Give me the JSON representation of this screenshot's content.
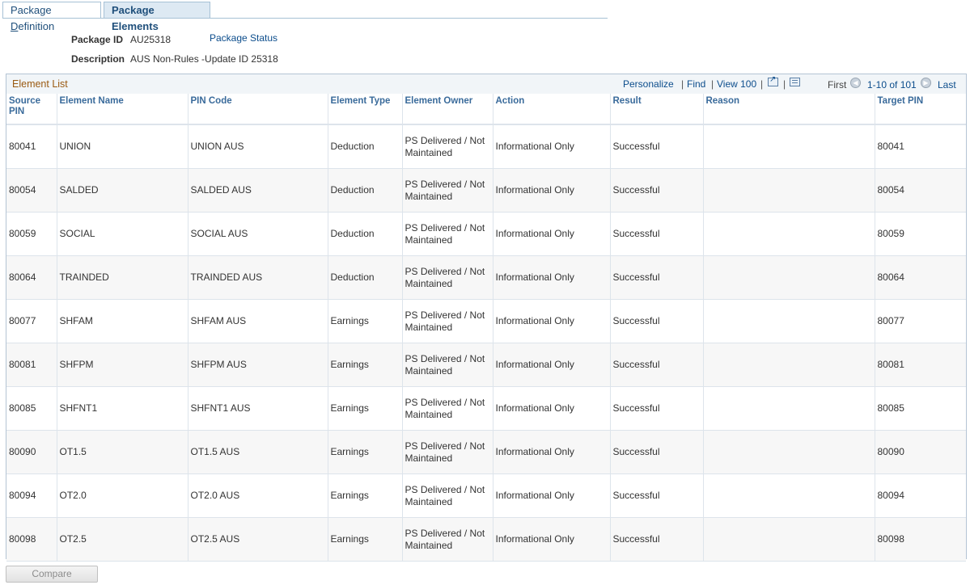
{
  "tabs": {
    "definition_pre": "Package ",
    "definition_underline": "D",
    "definition_post": "efinition",
    "elements": "Package Elements"
  },
  "header": {
    "package_id_label": "Package ID",
    "package_id_value": "AU25318",
    "package_status_link": "Package Status",
    "description_label": "Description",
    "description_value": "AUS Non-Rules -Update ID 25318"
  },
  "grid": {
    "title": "Element List",
    "personalize": "Personalize",
    "find": "Find",
    "view": "View 100",
    "separator": "|",
    "first": "First",
    "range": "1-10 of 101",
    "last": "Last",
    "columns": [
      "Source PIN",
      "Element Name",
      "PIN Code",
      "Element Type",
      "Element Owner",
      "Action",
      "Result",
      "Reason",
      "Target PIN"
    ],
    "rows": [
      {
        "source_pin": "80041",
        "element_name": "UNION",
        "pin_code": "UNION AUS",
        "element_type": "Deduction",
        "element_owner": "PS Delivered / Not Maintained",
        "action": "Informational Only",
        "result": "Successful",
        "reason": "",
        "target_pin": "80041"
      },
      {
        "source_pin": "80054",
        "element_name": "SALDED",
        "pin_code": "SALDED AUS",
        "element_type": "Deduction",
        "element_owner": "PS Delivered / Not Maintained",
        "action": "Informational Only",
        "result": "Successful",
        "reason": "",
        "target_pin": "80054"
      },
      {
        "source_pin": "80059",
        "element_name": "SOCIAL",
        "pin_code": "SOCIAL AUS",
        "element_type": "Deduction",
        "element_owner": "PS Delivered / Not Maintained",
        "action": "Informational Only",
        "result": "Successful",
        "reason": "",
        "target_pin": "80059"
      },
      {
        "source_pin": "80064",
        "element_name": "TRAINDED",
        "pin_code": "TRAINDED AUS",
        "element_type": "Deduction",
        "element_owner": "PS Delivered / Not Maintained",
        "action": "Informational Only",
        "result": "Successful",
        "reason": "",
        "target_pin": "80064"
      },
      {
        "source_pin": "80077",
        "element_name": "SHFAM",
        "pin_code": "SHFAM AUS",
        "element_type": "Earnings",
        "element_owner": "PS Delivered / Not Maintained",
        "action": "Informational Only",
        "result": "Successful",
        "reason": "",
        "target_pin": "80077"
      },
      {
        "source_pin": "80081",
        "element_name": "SHFPM",
        "pin_code": "SHFPM AUS",
        "element_type": "Earnings",
        "element_owner": "PS Delivered / Not Maintained",
        "action": "Informational Only",
        "result": "Successful",
        "reason": "",
        "target_pin": "80081"
      },
      {
        "source_pin": "80085",
        "element_name": "SHFNT1",
        "pin_code": "SHFNT1 AUS",
        "element_type": "Earnings",
        "element_owner": "PS Delivered / Not Maintained",
        "action": "Informational Only",
        "result": "Successful",
        "reason": "",
        "target_pin": "80085"
      },
      {
        "source_pin": "80090",
        "element_name": "OT1.5",
        "pin_code": "OT1.5 AUS",
        "element_type": "Earnings",
        "element_owner": "PS Delivered / Not Maintained",
        "action": "Informational Only",
        "result": "Successful",
        "reason": "",
        "target_pin": "80090"
      },
      {
        "source_pin": "80094",
        "element_name": "OT2.0",
        "pin_code": "OT2.0 AUS",
        "element_type": "Earnings",
        "element_owner": "PS Delivered / Not Maintained",
        "action": "Informational Only",
        "result": "Successful",
        "reason": "",
        "target_pin": "80094"
      },
      {
        "source_pin": "80098",
        "element_name": "OT2.5",
        "pin_code": "OT2.5 AUS",
        "element_type": "Earnings",
        "element_owner": "PS Delivered / Not Maintained",
        "action": "Informational Only",
        "result": "Successful",
        "reason": "",
        "target_pin": "80098"
      }
    ]
  },
  "footer": {
    "compare_button": "Compare"
  },
  "colors": {
    "link": "#0c4d8c",
    "grid_title": "#9a5a12",
    "column_header": "#3a6b9b",
    "active_tab": "#dde9f3"
  }
}
